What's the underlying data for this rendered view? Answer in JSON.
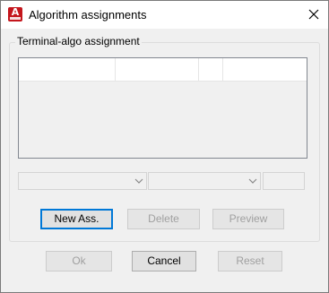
{
  "window": {
    "title": "Algorithm assignments",
    "icon": "autocad-app-icon",
    "icon_letter": "A"
  },
  "group": {
    "label": "Terminal-algo assignment"
  },
  "list": {
    "columns": [
      "",
      "",
      "",
      ""
    ],
    "rows": []
  },
  "combos": [
    {
      "value": ""
    },
    {
      "value": ""
    }
  ],
  "field": {
    "value": ""
  },
  "buttons": {
    "new_ass": "New Ass.",
    "delete": "Delete",
    "preview": "Preview",
    "ok": "Ok",
    "cancel": "Cancel",
    "reset": "Reset"
  },
  "colors": {
    "accent": "#0078d7",
    "app_icon": "#c4161c",
    "disabled_text": "#a0a0a0"
  }
}
